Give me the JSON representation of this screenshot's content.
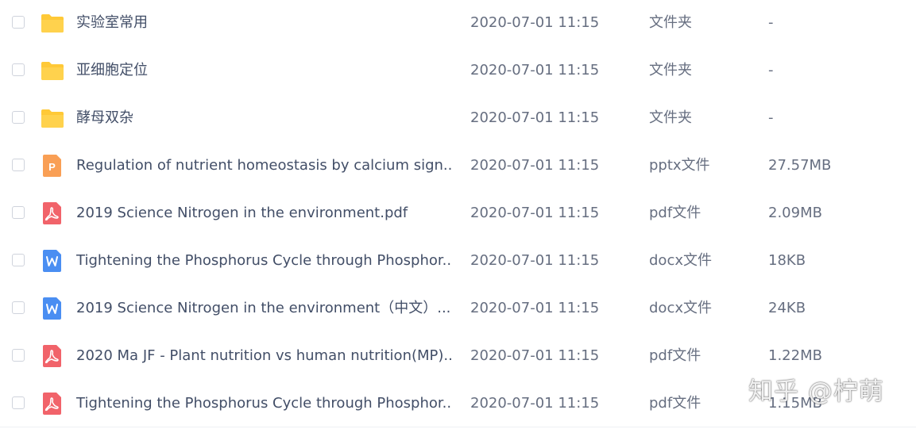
{
  "files": [
    {
      "name": "实验室常用",
      "date": "2020-07-01 11:15",
      "type": "文件夹",
      "size": "-",
      "icon": "folder-icon"
    },
    {
      "name": "亚细胞定位",
      "date": "2020-07-01 11:15",
      "type": "文件夹",
      "size": "-",
      "icon": "folder-icon"
    },
    {
      "name": "酵母双杂",
      "date": "2020-07-01 11:15",
      "type": "文件夹",
      "size": "-",
      "icon": "folder-icon"
    },
    {
      "name": "Regulation of nutrient homeostasis by calcium sign...",
      "date": "2020-07-01 11:15",
      "type": "pptx文件",
      "size": "27.57MB",
      "icon": "pptx-icon"
    },
    {
      "name": "2019 Science Nitrogen in the environment.pdf",
      "date": "2020-07-01 11:15",
      "type": "pdf文件",
      "size": "2.09MB",
      "icon": "pdf-icon"
    },
    {
      "name": "Tightening the Phosphorus Cycle through Phosphor...",
      "date": "2020-07-01 11:15",
      "type": "docx文件",
      "size": "18KB",
      "icon": "docx-icon"
    },
    {
      "name": "2019 Science Nitrogen in the environment（中文）....",
      "date": "2020-07-01 11:15",
      "type": "docx文件",
      "size": "24KB",
      "icon": "docx-icon"
    },
    {
      "name": "2020 Ma JF - Plant nutrition vs human nutrition(MP)...",
      "date": "2020-07-01 11:15",
      "type": "pdf文件",
      "size": "1.22MB",
      "icon": "pdf-icon"
    },
    {
      "name": "Tightening the Phosphorus Cycle through Phosphor...",
      "date": "2020-07-01 11:15",
      "type": "pdf文件",
      "size": "1.15MB",
      "icon": "pdf-icon"
    }
  ],
  "watermark": "知乎 @柠萌",
  "colors": {
    "folder": "#ffc937",
    "pptx": "#f99f55",
    "pdf": "#f1636a",
    "docx": "#4a8ef2",
    "text": "#424e67"
  }
}
